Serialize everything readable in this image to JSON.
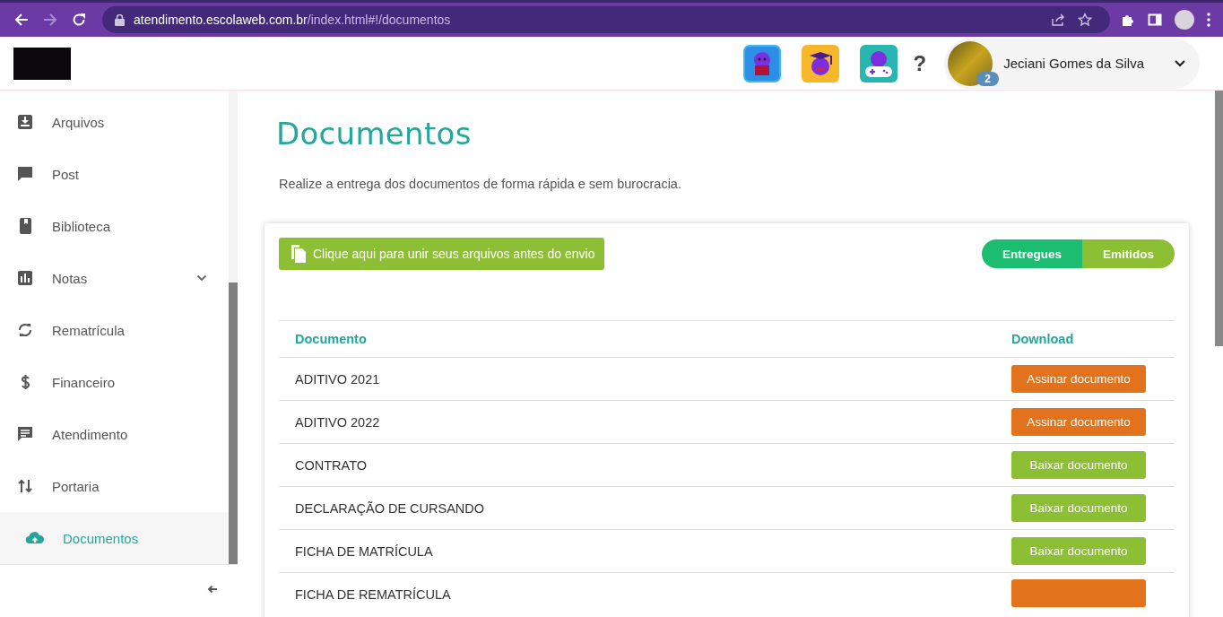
{
  "browser": {
    "url_host": "atendimento.escolaweb.com.br",
    "url_path": "/index.html#!/documentos"
  },
  "header": {
    "help": "?",
    "user": {
      "name": "Jeciani Gomes da Silva",
      "badge": "2"
    }
  },
  "sidebar": {
    "items": [
      {
        "label": "Arquivos",
        "selected": false,
        "expandable": false
      },
      {
        "label": "Post",
        "selected": false,
        "expandable": false
      },
      {
        "label": "Biblioteca",
        "selected": false,
        "expandable": false
      },
      {
        "label": "Notas",
        "selected": false,
        "expandable": true
      },
      {
        "label": "Rematrícula",
        "selected": false,
        "expandable": false
      },
      {
        "label": "Financeiro",
        "selected": false,
        "expandable": false
      },
      {
        "label": "Atendimento",
        "selected": false,
        "expandable": false
      },
      {
        "label": "Portaria",
        "selected": false,
        "expandable": false
      },
      {
        "label": "Documentos",
        "selected": true,
        "expandable": false
      }
    ]
  },
  "page": {
    "title": "Documentos",
    "subtitle": "Realize a entrega dos documentos de forma rápida e sem burocracia.",
    "merge_button": "Clique aqui para unir seus arquivos antes do envio",
    "tabs": [
      {
        "label": "Entregues",
        "selected": true
      },
      {
        "label": "Emitidos",
        "selected": false
      }
    ],
    "table": {
      "columns": [
        "Documento",
        "Download"
      ],
      "rows": [
        {
          "name": "ADITIVO 2021",
          "action": {
            "kind": "sign",
            "label": "Assinar documento"
          }
        },
        {
          "name": "ADITIVO 2022",
          "action": {
            "kind": "sign",
            "label": "Assinar documento"
          }
        },
        {
          "name": "CONTRATO",
          "action": {
            "kind": "download",
            "label": "Baixar documento"
          }
        },
        {
          "name": "DECLARAÇÃO DE CURSANDO",
          "action": {
            "kind": "download",
            "label": "Baixar documento"
          }
        },
        {
          "name": "FICHA DE MATRÍCULA",
          "action": {
            "kind": "download",
            "label": "Baixar documento"
          }
        },
        {
          "name": "FICHA DE REMATRÍCULA",
          "action": {
            "kind": "sign"
          }
        }
      ]
    }
  }
}
